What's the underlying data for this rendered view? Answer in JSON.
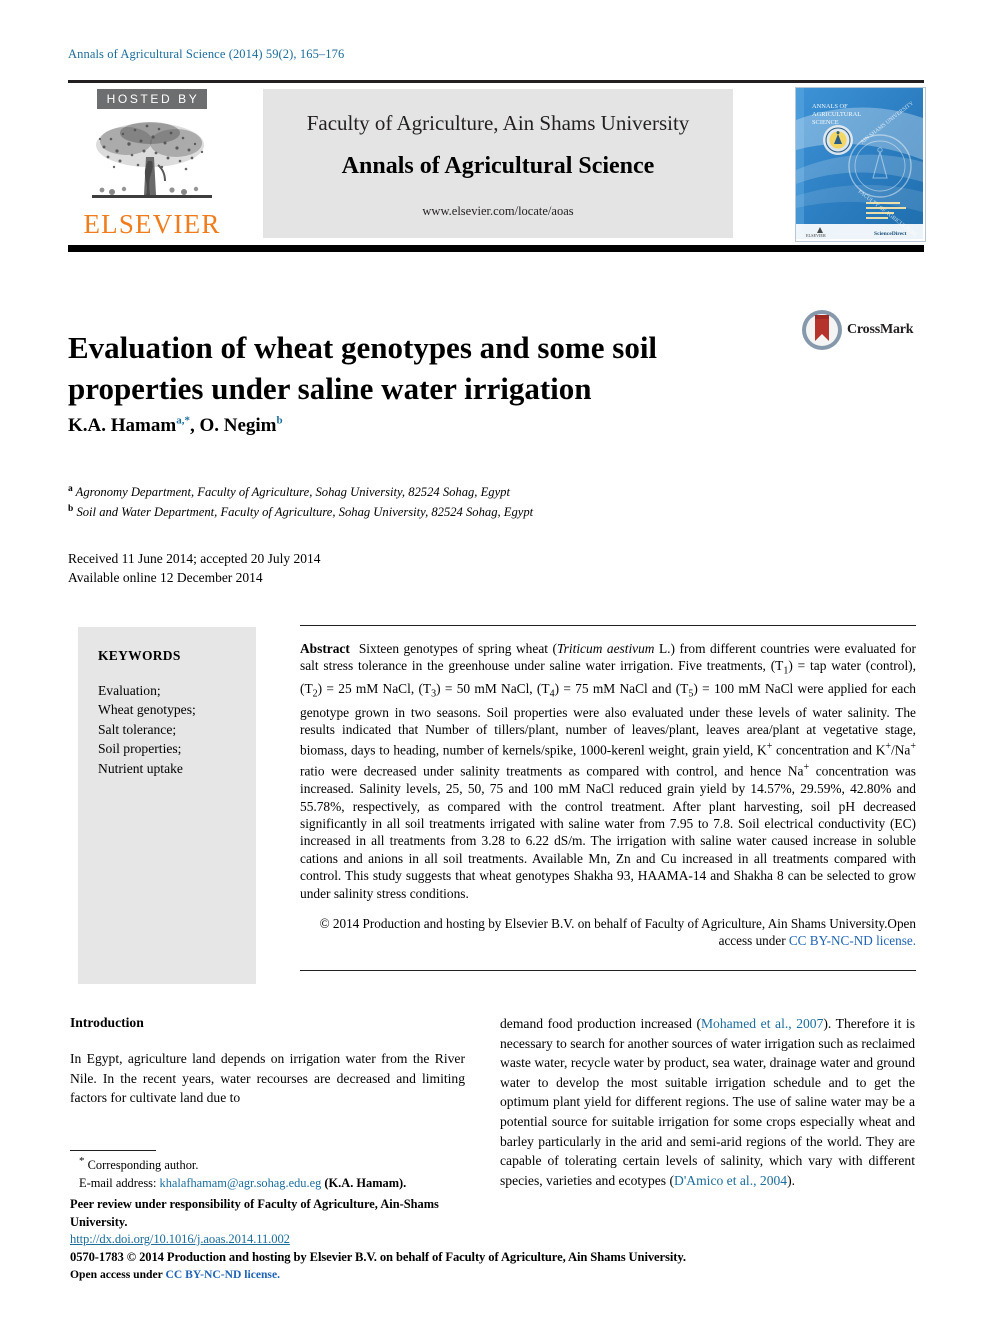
{
  "running_head": "Annals of Agricultural Science (2014) 59(2), 165–176",
  "masthead": {
    "hosted_by": "HOSTED BY",
    "publisher": "ELSEVIER",
    "faculty": "Faculty of Agriculture, Ain Shams University",
    "journal": "Annals of Agricultural Science",
    "url": "www.elsevier.com/locate/aoas",
    "cover_title_line1": "ANNALS OF",
    "cover_title_line2": "AGRICULTURAL",
    "cover_title_line3": "SCIENCE",
    "cover_watermark_top": "AIN SHAMS UNIVERSITY",
    "cover_watermark_bottom": "FACULTY OF AGRICULTURE",
    "cover_footer_left": "ELSEVIER",
    "cover_footer_right": "ScienceDirect"
  },
  "article": {
    "title": "Evaluation of wheat genotypes and some soil properties under saline water irrigation",
    "crossmark_label": "CrossMark",
    "authors": [
      {
        "name": "K.A. Hamam",
        "marks": "a,*"
      },
      {
        "name": "O. Negim",
        "marks": "b"
      }
    ],
    "affiliations": [
      {
        "mark": "a",
        "text": "Agronomy Department, Faculty of Agriculture, Sohag University, 82524 Sohag, Egypt"
      },
      {
        "mark": "b",
        "text": "Soil and Water Department, Faculty of Agriculture, Sohag University, 82524 Sohag, Egypt"
      }
    ],
    "history": [
      "Received 11 June 2014; accepted 20 July 2014",
      "Available online 12 December 2014"
    ]
  },
  "keywords": {
    "heading": "KEYWORDS",
    "items": [
      "Evaluation;",
      "Wheat genotypes;",
      "Salt tolerance;",
      "Soil properties;",
      "Nutrient uptake"
    ]
  },
  "abstract": {
    "label": "Abstract",
    "p1_a": "Sixteen genotypes of spring wheat (",
    "species": "Triticum aestivum",
    "p1_b": " L.) from different countries were evaluated for salt stress tolerance in the greenhouse under saline water irrigation. Five treatments, (T",
    "t1": "1",
    "p1_c": ") = tap water (control), (T",
    "t2": "2",
    "p1_d": ") = 25 mM NaCl, (T",
    "t3": "3",
    "p1_e": ") = 50 mM NaCl, (T",
    "t4": "4",
    "p1_f": ") = 75 mM NaCl and (T",
    "t5": "5",
    "p1_g": ") = 100 mM NaCl were applied for each genotype grown in two seasons. Soil properties were also evaluated under these levels of water salinity. The results indicated that Number of tillers/plant, number of leaves/plant, leaves area/plant at vegetative stage, biomass, days to heading, number of kernels/spike, 1000-kerenl weight, grain yield, K",
    "sup_plus_1": "+",
    "p1_h": " concentration and K",
    "sup_plus_2": "+",
    "p1_i": "/Na",
    "sup_plus_3": "+",
    "p1_j": " ratio were decreased under salinity treatments as compared with control, and hence Na",
    "sup_plus_4": "+",
    "p1_k": " concentration was increased. Salinity levels, 25, 50, 75 and 100 mM NaCl reduced grain yield by 14.57%, 29.59%, 42.80% and 55.78%, respectively, as compared with the control treatment. After plant harvesting, soil pH decreased significantly in all soil treatments irrigated with saline water from 7.95 to 7.8. Soil electrical conductivity (EC) increased in all treatments from 3.28 to 6.22 dS/m. The irrigation with saline water caused increase in soluble cations and anions in all soil treatments. Available Mn, Zn and Cu increased in all treatments compared with control. This study suggests that wheat genotypes Shakha 93, HAAMA-14 and Shakha 8 can be selected to grow under salinity stress conditions.",
    "copyright": "© 2014 Production and hosting by Elsevier B.V. on behalf of Faculty of Agriculture, Ain Shams University.",
    "open_access_prefix": "Open access under ",
    "license_link": "CC BY-NC-ND license."
  },
  "body": {
    "section_heading": "Introduction",
    "left_col": "In Egypt, agriculture land depends on irrigation water from the River Nile. In the recent years, water recourses are decreased and limiting factors for cultivate land due to",
    "right_col_a": "demand food production increased (",
    "citation_1": "Mohamed et al., 2007",
    "right_col_b": "). Therefore it is necessary to search for another sources of water irrigation such as reclaimed waste water, recycle water by product, sea water, drainage water and ground water to develop the most suitable irrigation schedule and to get the optimum plant yield for different regions. The use of saline water may be a potential source for suitable irrigation for some crops especially wheat and barley particularly in the arid and semi-arid regions of the world. They are capable of tolerating certain levels of salinity, which vary with different species, varieties and ecotypes (",
    "citation_2": "D'Amico et al., 2004",
    "right_col_c": ")."
  },
  "footnotes": {
    "corresponding": "Corresponding author.",
    "email_label": "E-mail address: ",
    "email": "khalafhamam@agr.sohag.edu.eg",
    "email_suffix": " (K.A. Hamam).",
    "peer_review": "Peer review under responsibility of Faculty of Agriculture, Ain-Shams University."
  },
  "legal": {
    "doi": "http://dx.doi.org/10.1016/j.aoas.2014.11.002",
    "issn_line": "0570-1783 © 2014 Production and hosting by Elsevier B.V. on behalf of Faculty of Agriculture, Ain Shams University.",
    "open_access_prefix": "Open access under ",
    "license_link": "CC BY-NC-ND license."
  },
  "colors": {
    "link_blue": "#1e63b4",
    "link_teal": "#1b6d9c",
    "elsevier_orange": "#f07c1b",
    "panel_gray": "#e6e6e6",
    "masthead_gray": "#e4e4e4",
    "hosted_gray": "#6d6e70",
    "crossmark_red": "#b5332b",
    "crossmark_blue": "#7b93ab",
    "cover_blue": "#2e7fc4"
  }
}
